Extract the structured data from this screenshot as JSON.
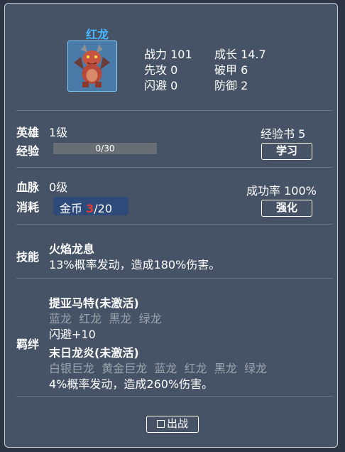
{
  "hero": {
    "name": "红龙",
    "portrait_icon": "red-dragon-portrait",
    "stats": {
      "power_label": "战力",
      "power": "101",
      "growth_label": "成长",
      "growth": "14.7",
      "initiative_label": "先攻",
      "initiative": "0",
      "armor_break_label": "破甲",
      "armor_break": "6",
      "dodge_label": "闪避",
      "dodge": "0",
      "defense_label": "防御",
      "defense": "2"
    }
  },
  "level_section": {
    "hero_label": "英雄",
    "hero_level": "1级",
    "exp_label": "经验",
    "exp_current": 0,
    "exp_max": 30,
    "exp_text": "0/30",
    "exp_book_label": "经验书",
    "exp_book_count": "5",
    "learn_button": "学习"
  },
  "bloodline_section": {
    "bloodline_label": "血脉",
    "bloodline_level": "0级",
    "cost_label": "消耗",
    "coin_label": "金币",
    "coin_current": "3",
    "coin_required": "/20",
    "success_rate_label": "成功率",
    "success_rate": "100%",
    "enhance_button": "强化"
  },
  "skill_section": {
    "label": "技能",
    "skill_name": "火焰龙息",
    "skill_desc": "13%概率发动，造成180%伤害。"
  },
  "bond_section": {
    "label": "羁绊",
    "bonds": [
      {
        "title": "提亚马特(未激活)",
        "members": [
          "蓝龙",
          "红龙",
          "黑龙",
          "绿龙"
        ],
        "effect": "闪避+10"
      },
      {
        "title": "末日龙炎(未激活)",
        "members": [
          "白银巨龙",
          "黄金巨龙",
          "蓝龙",
          "红龙",
          "黑龙",
          "绿龙"
        ],
        "effect": "4%概率发动，造成260%伤害。"
      }
    ]
  },
  "deploy": {
    "checked": false,
    "label": "出战"
  },
  "colors": {
    "panel_bg": "#465366",
    "hero_name": "#47b7ff",
    "coin_highlight": "#e53935",
    "inactive_member": "#9aa3ad"
  }
}
